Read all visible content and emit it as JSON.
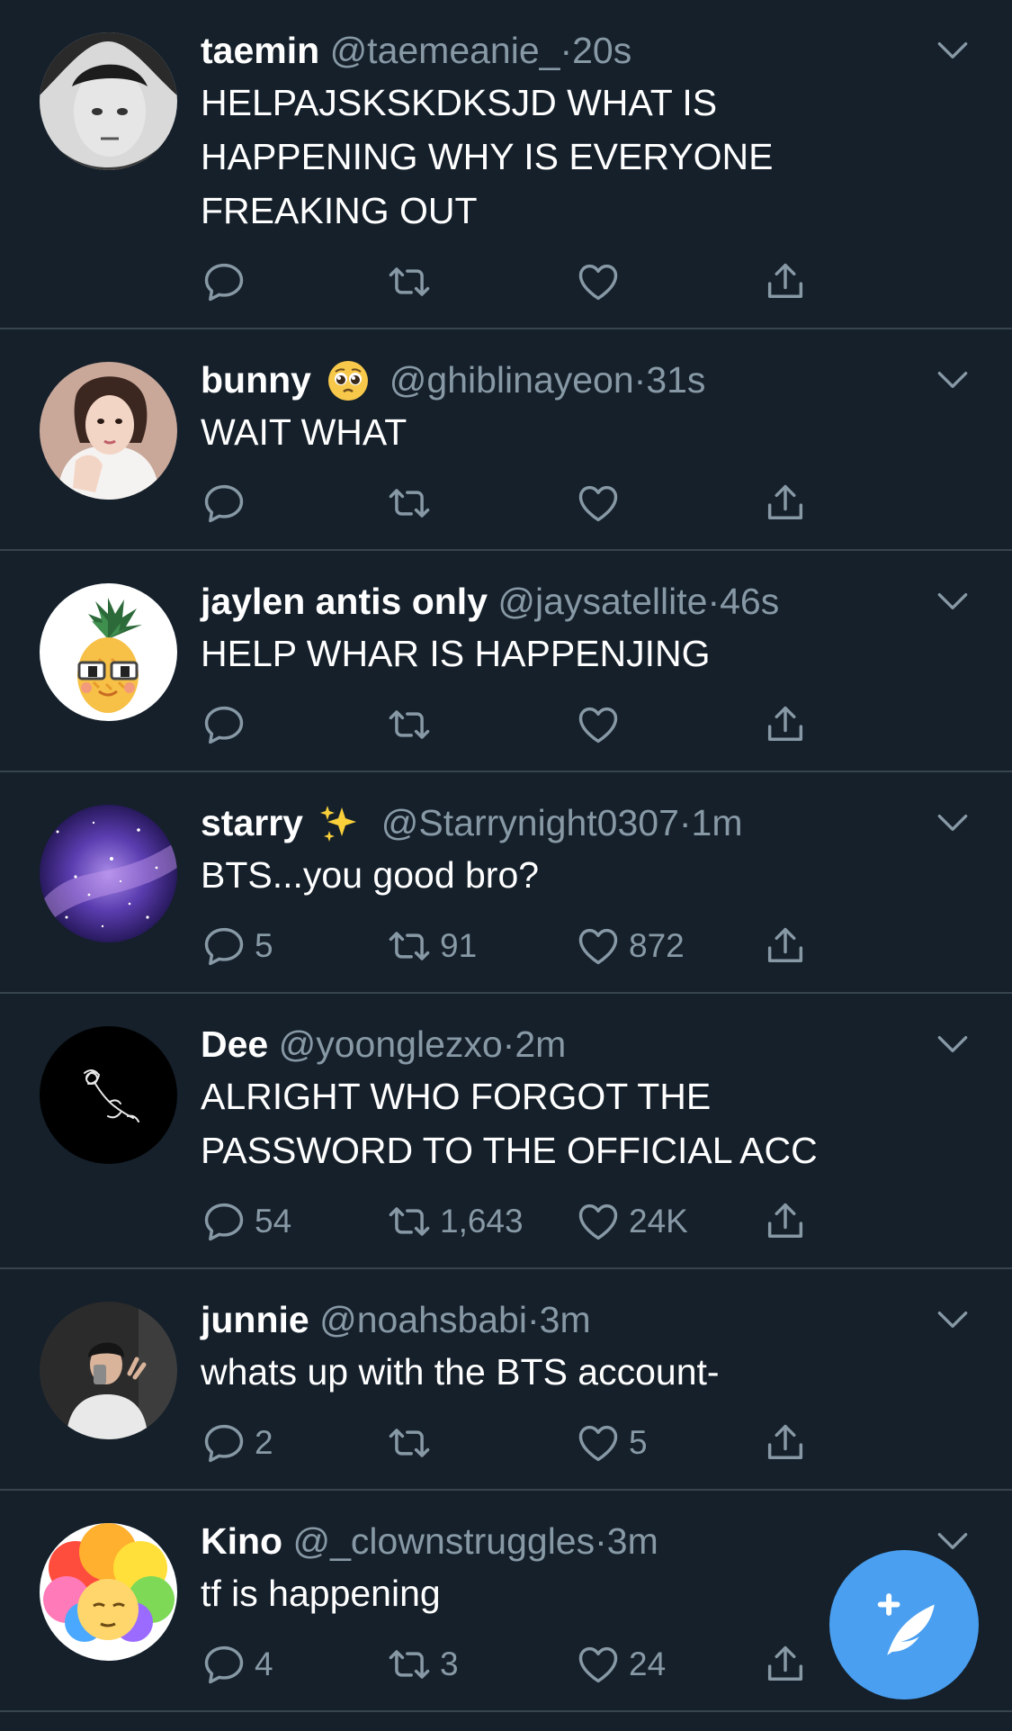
{
  "tweets": [
    {
      "name": "taemin",
      "handle": "@taemeanie_",
      "dot": "·",
      "time": "20s",
      "text": "HELPAJSKSKDKSJD WHAT IS HAPPENING WHY IS EVERYONE FREAKING OUT",
      "replies": "",
      "retweets": "",
      "likes": ""
    },
    {
      "name": "bunny",
      "emoji": "pleading-face",
      "handle": "@ghiblinayeon",
      "dot": "·",
      "time": "31s",
      "text": "WAIT WHAT",
      "replies": "",
      "retweets": "",
      "likes": ""
    },
    {
      "name": "jaylen antis only",
      "handle": "@jaysatellite",
      "dot": "·",
      "time": "46s",
      "text": "HELP WHAR IS HAPPENJING",
      "replies": "",
      "retweets": "",
      "likes": ""
    },
    {
      "name": "starry",
      "emoji": "sparkles",
      "handle": "@Starrynight0307",
      "dot": "·",
      "time": "1m",
      "text": "BTS...you good bro?",
      "replies": "5",
      "retweets": "91",
      "likes": "872"
    },
    {
      "name": "Dee",
      "handle": "@yoonglezxo",
      "dot": "·",
      "time": "2m",
      "text": "ALRIGHT WHO FORGOT THE PASSWORD TO THE OFFICIAL ACC",
      "replies": "54",
      "retweets": "1,643",
      "likes": "24K"
    },
    {
      "name": "junnie",
      "handle": "@noahsbabi",
      "dot": "·",
      "time": "3m",
      "text": "whats up with the BTS account-",
      "replies": "2",
      "retweets": "",
      "likes": "5"
    },
    {
      "name": "Kino",
      "handle": "@_clownstruggles",
      "dot": "·",
      "time": "3m",
      "text": "tf is happening",
      "replies": "4",
      "retweets": "3",
      "likes": "24"
    }
  ],
  "colors": {
    "background": "#15202b",
    "divider": "#38444d",
    "secondary_text": "#8899a6",
    "accent": "#4a9ff0"
  },
  "icons": {
    "reply": "reply-icon",
    "retweet": "retweet-icon",
    "like": "heart-icon",
    "share": "share-icon",
    "more": "chevron-down-icon",
    "compose": "compose-tweet-icon"
  }
}
